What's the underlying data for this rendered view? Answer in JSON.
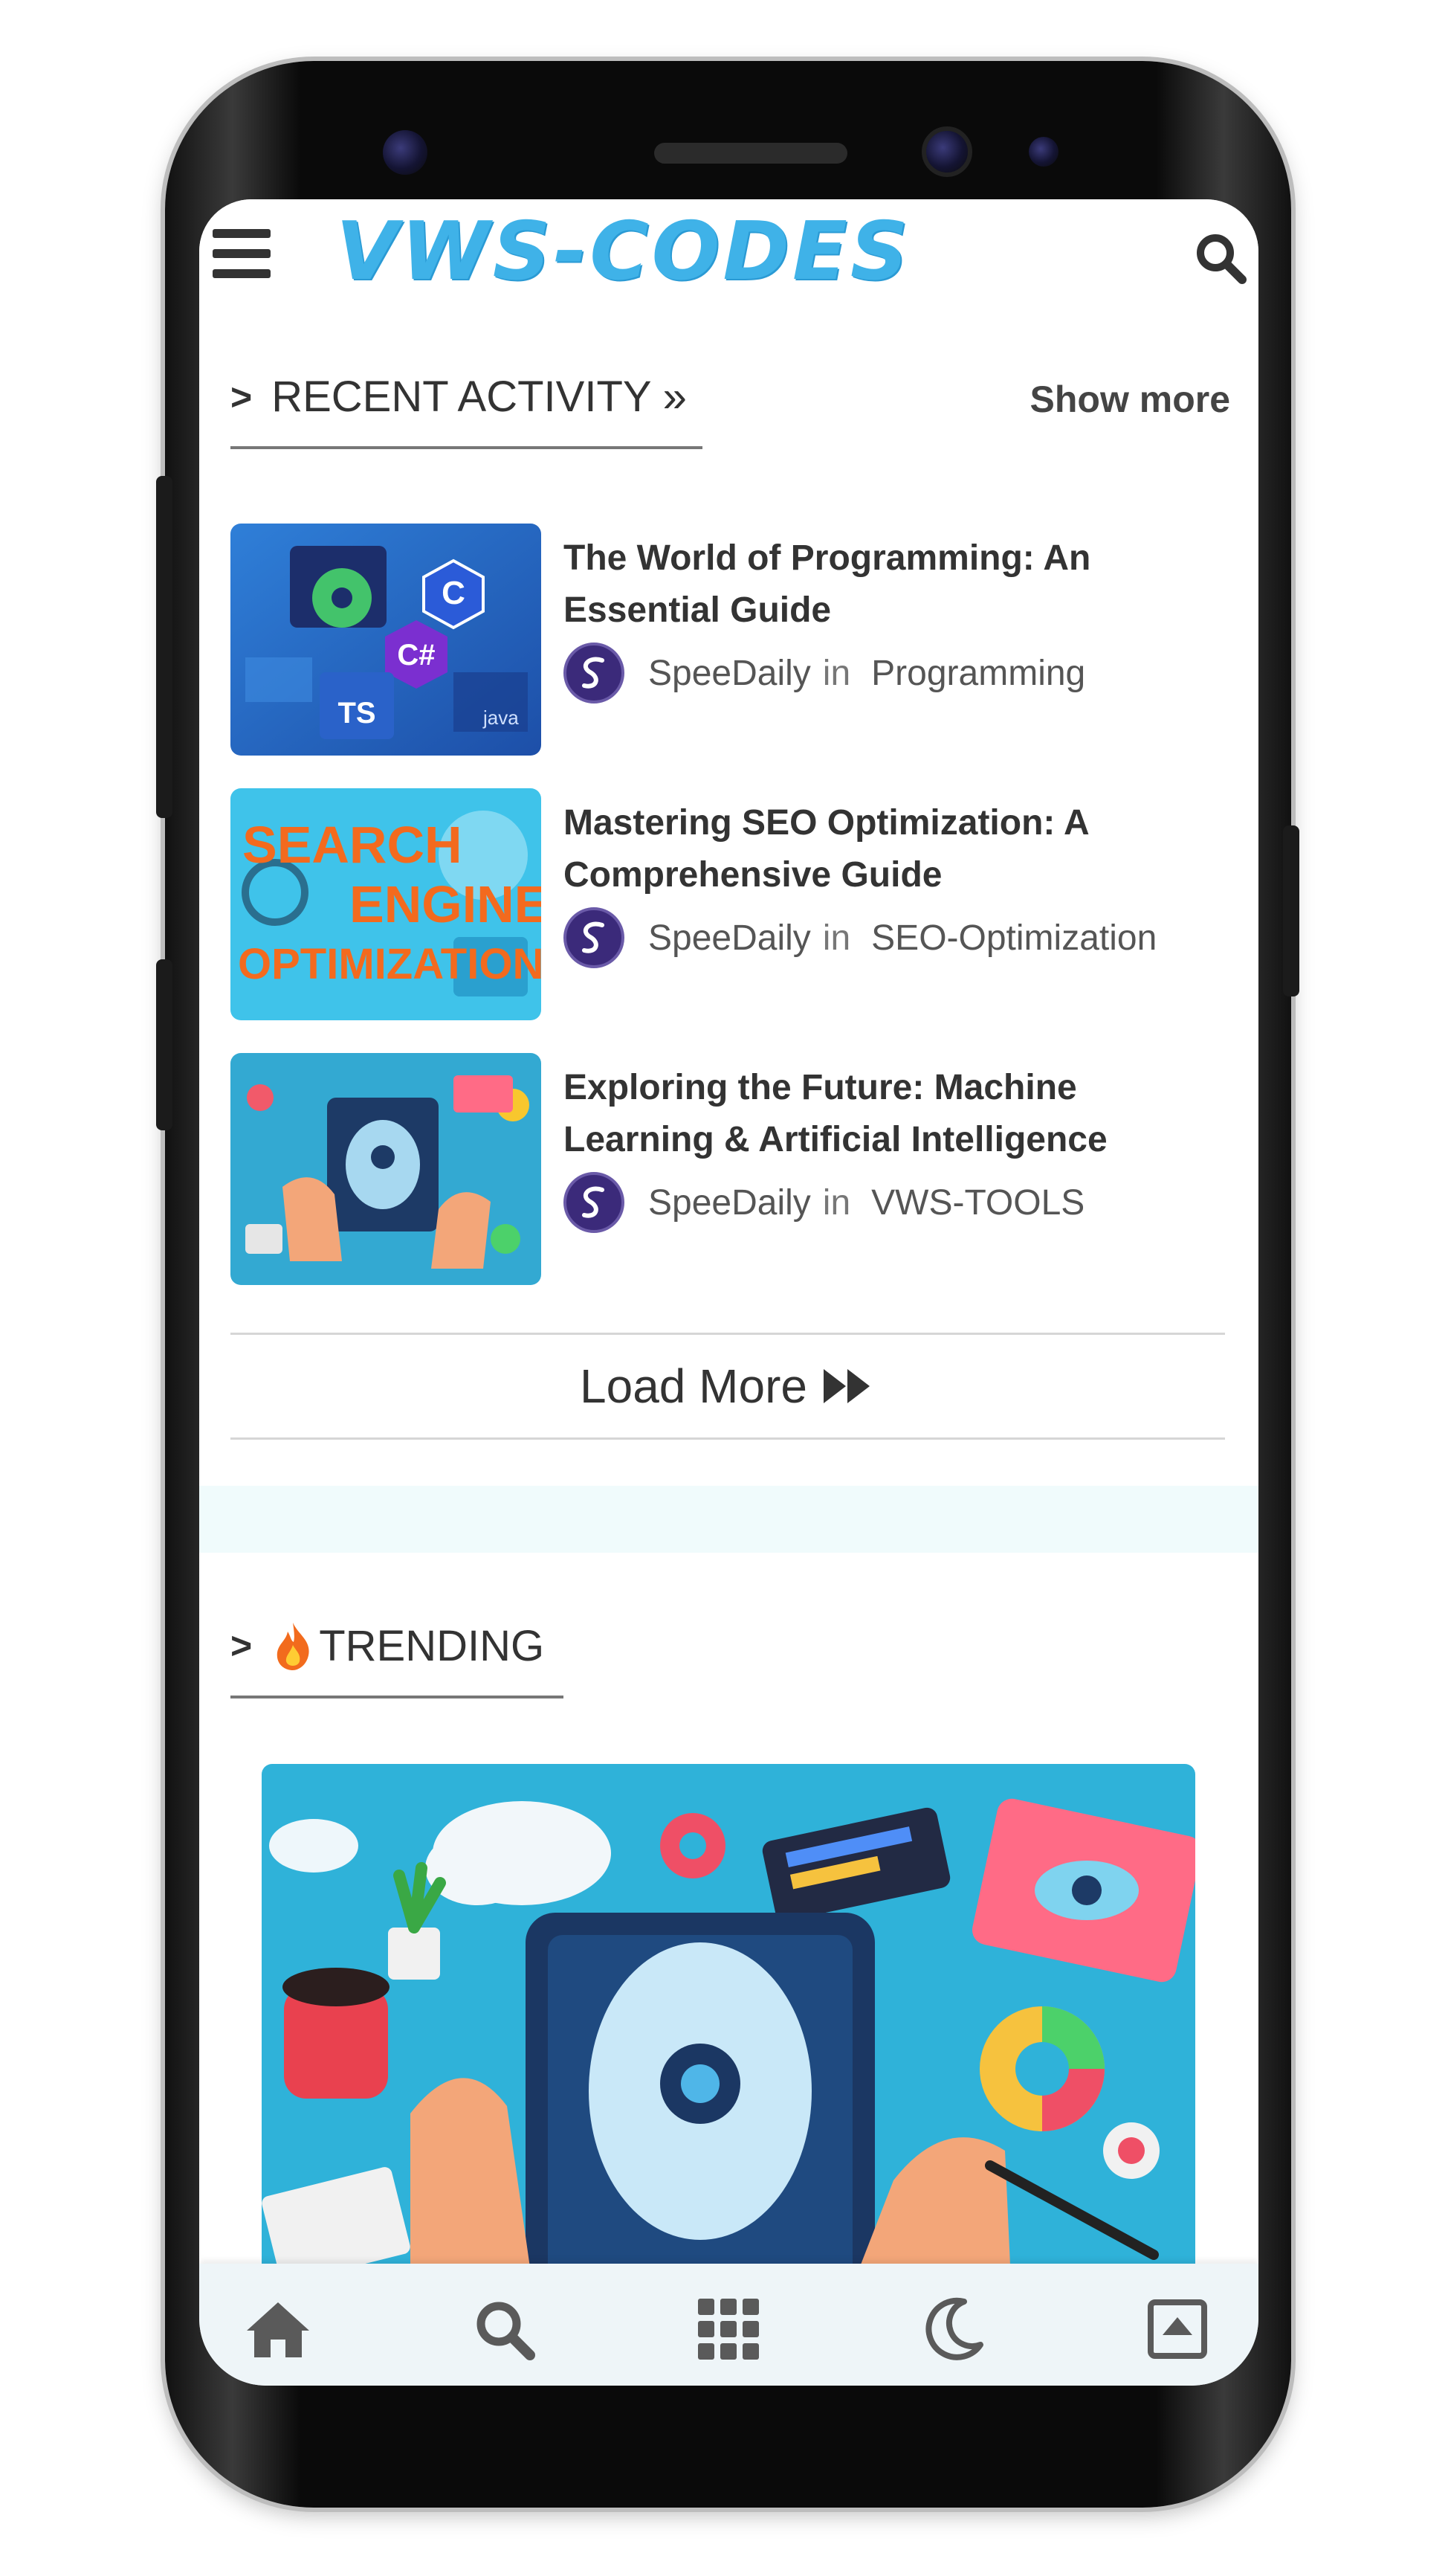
{
  "header": {
    "logo": "VWS-CODES",
    "menu_icon": "hamburger-menu-icon",
    "search_icon": "search-icon"
  },
  "recent": {
    "heading": "RECENT ACTIVITY »",
    "show_more": "Show more",
    "posts": [
      {
        "title": "The World of Programming: An Essential Guide",
        "author": "SpeeDaily",
        "in": "in",
        "category": "Programming"
      },
      {
        "title": "Mastering SEO Optimization: A Comprehensive Guide",
        "author": "SpeeDaily",
        "in": "in",
        "category": "SEO-Optimization"
      },
      {
        "title": "Exploring the Future: Machine Learning & Artificial Intelligence",
        "author": "SpeeDaily",
        "in": "in",
        "category": "VWS-TOOLS"
      }
    ],
    "load_more": "Load More"
  },
  "thumb_text": {
    "seo_line1": "SEARCH",
    "seo_line2": "ENGINE",
    "seo_line3": "OPTIMIZATION!",
    "prog_ts": "TS",
    "prog_cs": "C#",
    "prog_java": "java"
  },
  "trending": {
    "heading": "TRENDING",
    "icon": "fire-icon"
  },
  "bottom_nav": {
    "items": [
      "home-icon",
      "search-icon",
      "grid-icon",
      "moon-icon",
      "scroll-top-icon"
    ]
  },
  "colors": {
    "logo": "#3fb2e8",
    "text": "#333333",
    "band": "#f0fbfc",
    "nav_bg": "#eef5f8",
    "nav_icon": "#5a5a5a"
  }
}
